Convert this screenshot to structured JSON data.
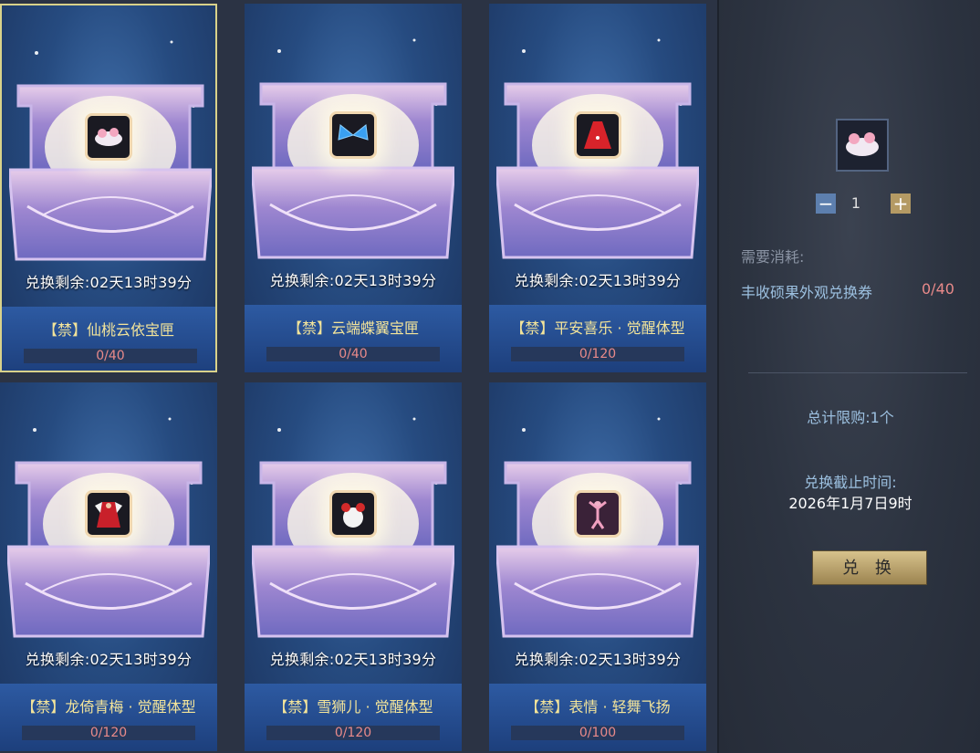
{
  "cards": [
    {
      "timer": "兑换剩余:02天13时39分",
      "name": "【禁】仙桃云依宝匣",
      "progress": "0/40",
      "icon": "cloud-peach-icon"
    },
    {
      "timer": "兑换剩余:02天13时39分",
      "name": "【禁】云端蝶翼宝匣",
      "progress": "0/40",
      "icon": "butterfly-wings-icon"
    },
    {
      "timer": "兑换剩余:02天13时39分",
      "name": "【禁】平安喜乐 · 觉醒体型",
      "progress": "0/120",
      "icon": "red-dress-icon"
    },
    {
      "timer": "兑换剩余:02天13时39分",
      "name": "【禁】龙倚青梅 · 觉醒体型",
      "progress": "0/120",
      "icon": "red-robe-icon"
    },
    {
      "timer": "兑换剩余:02天13时39分",
      "name": "【禁】雪狮儿 · 觉醒体型",
      "progress": "0/120",
      "icon": "snow-lion-icon"
    },
    {
      "timer": "兑换剩余:02天13时39分",
      "name": "【禁】表情 · 轻舞飞扬",
      "progress": "0/100",
      "icon": "dance-emote-icon"
    }
  ],
  "panel": {
    "quantity": "1",
    "cost_label": "需要消耗:",
    "cost_item": "丰收硕果外观兑换券",
    "cost_count": "0/40",
    "limit": "总计限购:1个",
    "deadline_label": "兑换截止时间:",
    "deadline": "2026年1月7日9时",
    "exchange_label": "兑 换"
  },
  "colors": {
    "accent_gold": "#f3e49a",
    "progress_red": "#e98a8a",
    "selected_border": "#d9d28a"
  }
}
